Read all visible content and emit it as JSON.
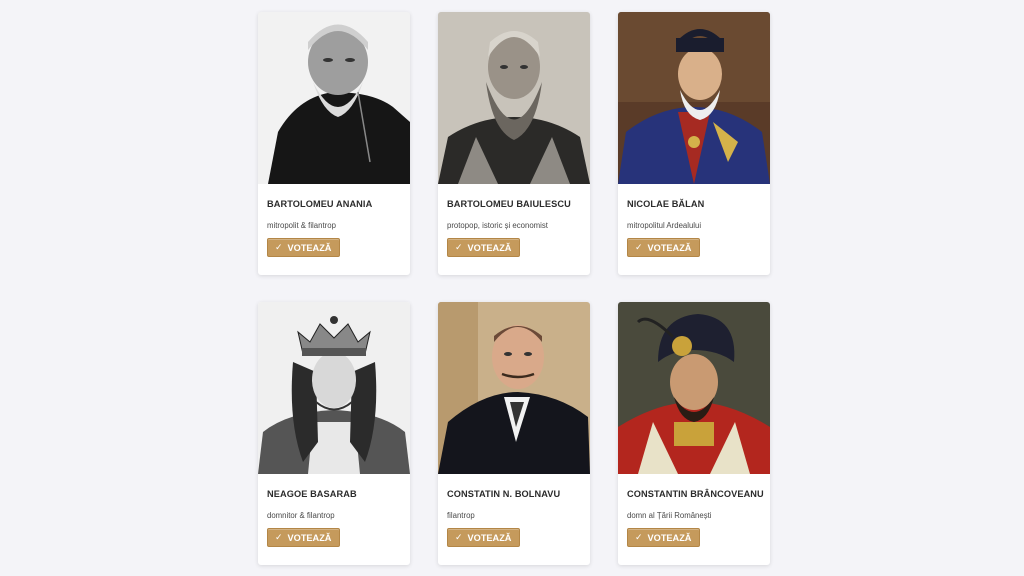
{
  "cards": [
    {
      "name": "BARTOLOMEU ANANIA",
      "description": "mitropolit & filantrop",
      "vote_label": "VOTEAZĂ",
      "portrait_icon": "bw-photo-bearded-priest"
    },
    {
      "name": "BARTOLOMEU BAIULESCU",
      "description": "protopop, istoric și economist",
      "vote_label": "VOTEAZĂ",
      "portrait_icon": "sepia-photo-bearded-man"
    },
    {
      "name": "NICOLAE BĂLAN",
      "description": "mitropolitul Ardealului",
      "vote_label": "VOTEAZĂ",
      "portrait_icon": "painting-metropolitan"
    },
    {
      "name": "NEAGOE BASARAB",
      "description": "domnitor & filantrop",
      "vote_label": "VOTEAZĂ",
      "portrait_icon": "engraving-crowned-prince"
    },
    {
      "name": "CONSTATIN N. BOLNAVU",
      "description": "filantrop",
      "vote_label": "VOTEAZĂ",
      "portrait_icon": "sepia-photo-man-suit"
    },
    {
      "name": "CONSTANTIN BRÂNCOVEANU",
      "description": "domn al Țării Românești",
      "vote_label": "VOTEAZĂ",
      "portrait_icon": "painting-prince-turban"
    }
  ],
  "colors": {
    "background": "#f4f4f8",
    "card": "#ffffff",
    "vote_button": "#c59a5c",
    "vote_text": "#ffffff",
    "name_text": "#2b2b2b"
  },
  "icons": {
    "check": "✓"
  }
}
